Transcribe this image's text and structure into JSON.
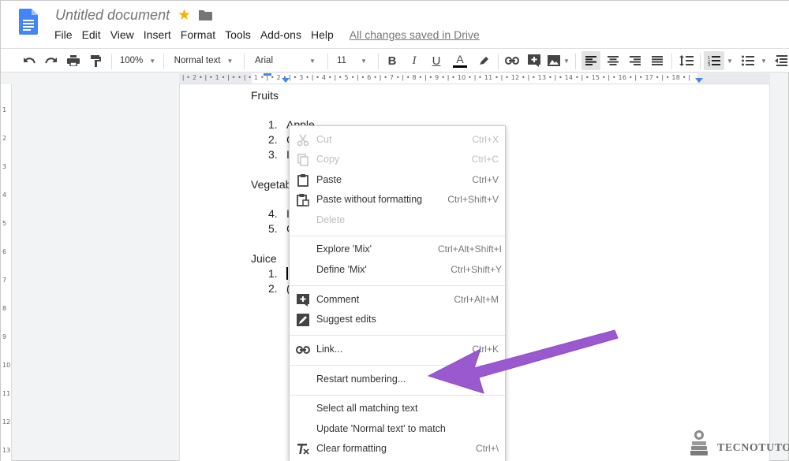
{
  "document": {
    "title": "Untitled document"
  },
  "menubar": {
    "items": [
      "File",
      "Edit",
      "View",
      "Insert",
      "Format",
      "Tools",
      "Add-ons",
      "Help"
    ],
    "saved_status": "All changes saved in Drive"
  },
  "toolbar": {
    "zoom": "100%",
    "style": "Normal text",
    "font": "Arial",
    "font_size": "11"
  },
  "ruler": {
    "top": "ǀ • 2 • ǀ • 1 • ǀ •   • ǀ • 1 • ǀ • 2 • ǀ • 3 • ǀ • 4 • ǀ • 5 • ǀ • 6 • ǀ • 7 • ǀ • 8 • ǀ • 9 • ǀ • 10 • ǀ • 11 • ǀ • 12 • ǀ • 13 • ǀ • 14 • ǀ • 15 • ǀ • 16 • ǀ • 17 • ǀ • 18 • ǀ",
    "left_numbers": [
      "1",
      "2",
      "3",
      "4",
      "5",
      "6",
      "7",
      "8",
      "9",
      "10",
      "11",
      "12",
      "13"
    ]
  },
  "content": {
    "heading_fruits": "Fruits",
    "fruit_items": [
      {
        "num": "1.",
        "text": "Apple"
      },
      {
        "num": "2.",
        "text": "C"
      },
      {
        "num": "3.",
        "text": "I"
      }
    ],
    "heading_veg": "Vegetab",
    "veg_items": [
      {
        "num": "4.",
        "text": "I"
      },
      {
        "num": "5.",
        "text": "C"
      }
    ],
    "heading_juice": "Juice",
    "juice_items": [
      {
        "num": "1.",
        "text": ""
      },
      {
        "num": "2.",
        "text": "("
      }
    ]
  },
  "context_menu": {
    "items": [
      {
        "label": "Cut",
        "shortcut": "Ctrl+X",
        "icon": "scissors-icon",
        "disabled": true
      },
      {
        "label": "Copy",
        "shortcut": "Ctrl+C",
        "icon": "copy-icon",
        "disabled": true
      },
      {
        "label": "Paste",
        "shortcut": "Ctrl+V",
        "icon": "clipboard-icon",
        "disabled": false
      },
      {
        "label": "Paste without formatting",
        "shortcut": "Ctrl+Shift+V",
        "icon": "clipboard-plain-icon",
        "disabled": false
      },
      {
        "label": "Delete",
        "shortcut": "",
        "icon": "",
        "disabled": true
      },
      {
        "label": "Explore 'Mix'",
        "shortcut": "Ctrl+Alt+Shift+I",
        "icon": "",
        "disabled": false
      },
      {
        "label": "Define 'Mix'",
        "shortcut": "Ctrl+Shift+Y",
        "icon": "",
        "disabled": false
      },
      {
        "label": "Comment",
        "shortcut": "Ctrl+Alt+M",
        "icon": "add-comment-icon",
        "disabled": false
      },
      {
        "label": "Suggest edits",
        "shortcut": "",
        "icon": "suggest-edit-icon",
        "disabled": false
      },
      {
        "label": "Link...",
        "shortcut": "Ctrl+K",
        "icon": "link-icon",
        "disabled": false
      },
      {
        "label": "Restart numbering...",
        "shortcut": "",
        "icon": "",
        "disabled": false
      },
      {
        "label": "Select all matching text",
        "shortcut": "",
        "icon": "",
        "disabled": false
      },
      {
        "label": "Update 'Normal text' to match",
        "shortcut": "",
        "icon": "",
        "disabled": false
      },
      {
        "label": "Clear formatting",
        "shortcut": "Ctrl+\\",
        "icon": "clear-format-icon",
        "disabled": false
      }
    ]
  },
  "watermark": {
    "text": "TECNOTUTO"
  },
  "colors": {
    "docs_blue": "#4285f4",
    "star": "#f4b400",
    "arrow": "#9b59d0"
  }
}
